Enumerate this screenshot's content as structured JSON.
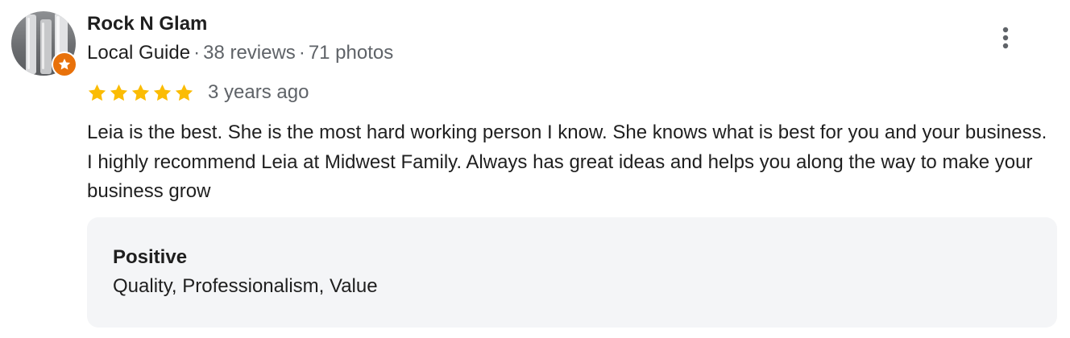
{
  "review": {
    "author": {
      "name": "Rock N Glam",
      "badge": "Local Guide",
      "reviews": "38 reviews",
      "photos": "71 photos",
      "separator": "·",
      "badge_icon": "star-badge-icon",
      "badge_color": "#e8710a"
    },
    "menu_icon": "more-vert-icon",
    "rating": {
      "stars": 5,
      "max": 5,
      "star_color": "#fbbc04",
      "time": "3 years ago"
    },
    "text": "Leia is the best. She is the most hard working person I know. She knows what is best for you and your business. I highly recommend Leia at Midwest Family. Always has great ideas and helps you along the way to make your business grow",
    "attributes": {
      "title": "Positive",
      "values": "Quality, Professionalism, Value"
    }
  }
}
